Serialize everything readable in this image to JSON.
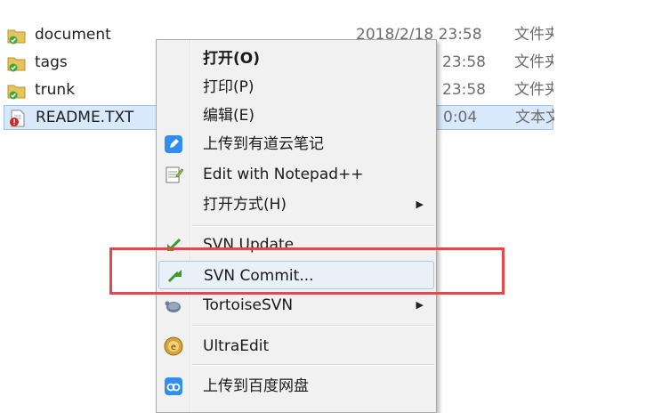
{
  "files": [
    {
      "name": "document",
      "date": "2018/2/18 23:58",
      "type": "文件夹",
      "icon": "svn-folder-icon"
    },
    {
      "name": "tags",
      "date": "23:58",
      "type": "文件夹",
      "icon": "svn-folder-icon"
    },
    {
      "name": "trunk",
      "date": "23:58",
      "type": "文件夹",
      "icon": "svn-folder-icon"
    },
    {
      "name": "README.TXT",
      "date": "0:04",
      "type": "文本文",
      "icon": "svn-modified-file-icon"
    }
  ],
  "context_menu": {
    "items": [
      {
        "label": "打开(O)",
        "bold": true
      },
      {
        "label": "打印(P)"
      },
      {
        "label": "编辑(E)"
      },
      {
        "label": "上传到有道云笔记",
        "icon": "youdao-note-icon"
      },
      {
        "label": "Edit with Notepad++",
        "icon": "notepad-plus-plus-icon"
      },
      {
        "label": "打开方式(H)",
        "submenu": true
      },
      {
        "label": "SVN Update",
        "icon": "svn-update-icon"
      },
      {
        "label": "SVN Commit...",
        "icon": "svn-commit-icon",
        "hover": true
      },
      {
        "label": "TortoiseSVN",
        "icon": "tortoisesvn-icon",
        "submenu": true
      },
      {
        "label": "UltraEdit",
        "icon": "ultraedit-icon"
      },
      {
        "label": "上传到百度网盘",
        "icon": "baidu-netdisk-icon"
      }
    ]
  },
  "colors": {
    "highlight_box": "#e8464a",
    "hover_bg": "#e8f0f8",
    "selected_row": "#d8e9fb"
  }
}
